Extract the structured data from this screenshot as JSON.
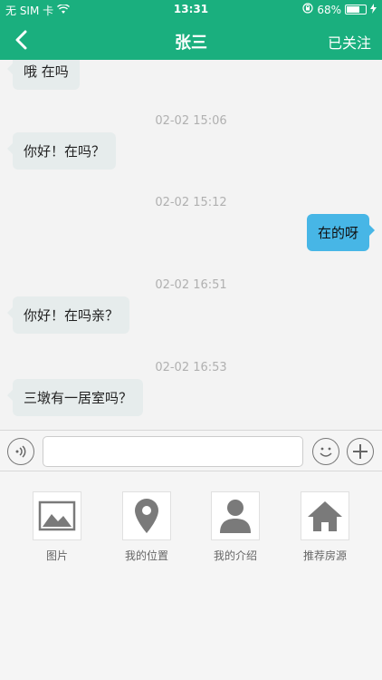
{
  "status_bar": {
    "carrier": "无 SIM 卡",
    "time": "13:31",
    "battery": "68%",
    "battery_level": 0.68,
    "icons": [
      "wifi-icon",
      "orientation-lock-icon",
      "battery-icon",
      "charging-icon"
    ]
  },
  "nav": {
    "title": "张三",
    "follow_label": "已关注",
    "back_icon": "chevron-left-icon"
  },
  "messages": [
    {
      "text": "哦 在吗",
      "from": "other"
    },
    {
      "time": "02-02 15:06"
    },
    {
      "text": "你好！在吗？",
      "from": "other"
    },
    {
      "time": "02-02 15:12"
    },
    {
      "text": "在的呀",
      "from": "me"
    },
    {
      "time": "02-02 16:51"
    },
    {
      "text": "你好！在吗亲？",
      "from": "other"
    },
    {
      "time": "02-02 16:53"
    },
    {
      "text": "三墩有一居室吗？",
      "from": "other"
    }
  ],
  "input_bar": {
    "value": "",
    "placeholder": "",
    "icons": [
      "voice-icon",
      "emoji-icon",
      "plus-icon"
    ]
  },
  "actions": [
    {
      "label": "图片",
      "icon": "image-icon"
    },
    {
      "label": "我的位置",
      "icon": "location-pin-icon"
    },
    {
      "label": "我的介绍",
      "icon": "person-icon"
    },
    {
      "label": "推荐房源",
      "icon": "house-icon"
    }
  ],
  "colors": {
    "brand": "#1aaf7e",
    "outgoing_bubble": "#47b6e6",
    "incoming_bubble": "#e6ecec",
    "timestamp": "#b0b0b0"
  }
}
